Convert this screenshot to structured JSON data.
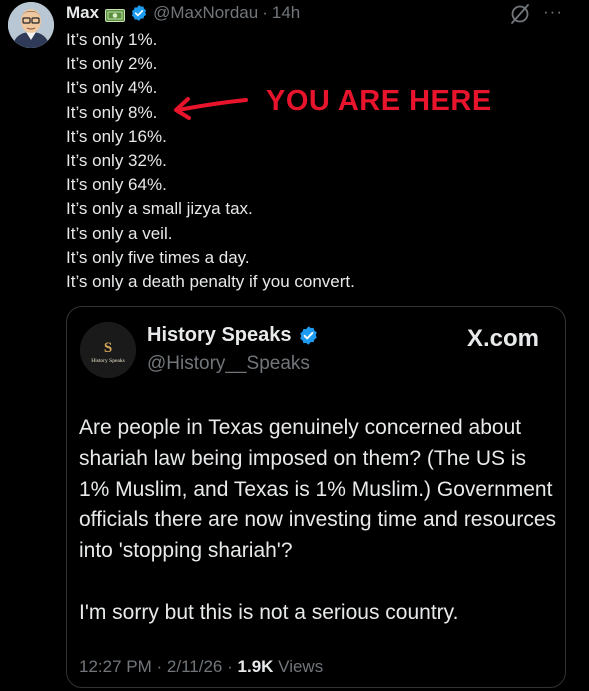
{
  "post": {
    "author_name": "Max",
    "handle": "@MaxNordau",
    "separator": "·",
    "time_ago": "14h",
    "more_label": "···",
    "lines": [
      "It’s only 1%.",
      "It’s only 2%.",
      "It’s only 4%.",
      "It’s only 8%.",
      "It’s only 16%.",
      "It’s only 32%.",
      "It’s only 64%.",
      "It’s only a small jizya tax.",
      "It’s only a veil.",
      "It’s only five times a day.",
      "It’s only a death penalty if you convert."
    ]
  },
  "annotation": {
    "text": "YOU ARE HERE",
    "color": "#e8142c"
  },
  "quote": {
    "author_name": "History Speaks",
    "handle": "@History__Speaks",
    "brand": "X.com",
    "avatar_text": "History Speaks",
    "paragraph_1": "Are people in Texas genuinely concerned about shariah law being imposed on them? (The US is 1% Muslim, and Texas is 1% Muslim.) Government officials there are now investing time and resources into 'stopping shariah'?",
    "paragraph_2": "I'm sorry but this is not a serious country.",
    "time": "12:27 PM",
    "separator": "·",
    "date": "2/11/26",
    "views_count": "1.9K",
    "views_label": "Views"
  },
  "colors": {
    "background": "#000000",
    "text": "#e7e9ea",
    "muted": "#71767b",
    "verified": "#1d9bf0",
    "border": "#2f3336"
  },
  "icons": [
    "avatar",
    "money-icon",
    "verified-icon",
    "grok-icon",
    "more-icon",
    "red-arrow"
  ]
}
